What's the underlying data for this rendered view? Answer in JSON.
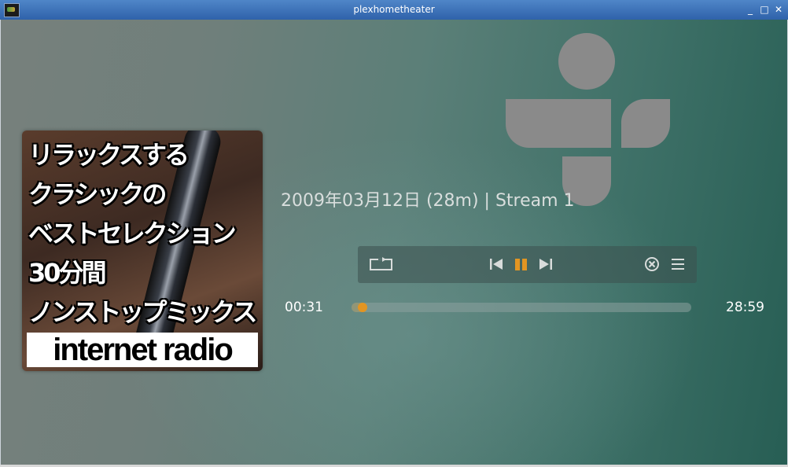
{
  "window": {
    "title": "plexhometheater",
    "minimize_label": "_",
    "maximize_label": "□",
    "close_label": "✕"
  },
  "album": {
    "lines": [
      "リラックスする",
      "クラシックの",
      "ベストセレクション",
      "30分間",
      "ノンストップミックス"
    ],
    "banner": "internet radio"
  },
  "track": {
    "info": "2009年03月12日 (28m) | Stream 1"
  },
  "player": {
    "elapsed": "00:31",
    "total": "28:59",
    "progress_fraction": 0.018,
    "state": "playing"
  },
  "colors": {
    "accent": "#e29522",
    "logo": "#8a8a8a"
  },
  "icons": {
    "repeat": "repeat-icon",
    "previous": "previous-icon",
    "pause": "pause-icon",
    "next": "next-icon",
    "stop": "stop-icon",
    "queue": "queue-icon"
  }
}
